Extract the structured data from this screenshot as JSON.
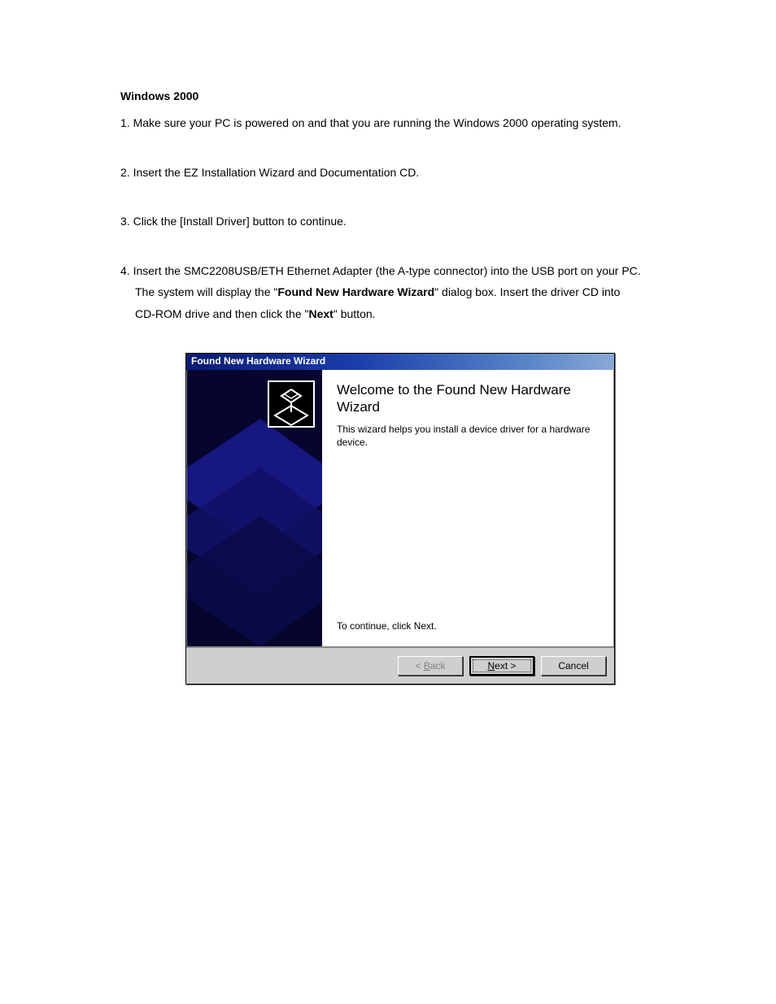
{
  "doc": {
    "heading": "Windows 2000",
    "step1_num": "1. ",
    "step1": "Make sure your PC is powered on and that you are running the Windows 2000 operating system.",
    "step2_num": "2. ",
    "step2": "Insert the EZ Installation Wizard and Documentation CD.",
    "step3_num": "3. ",
    "step3": "Click the [Install Driver] button to continue.",
    "step4_num": "4. ",
    "step4_a": "Insert the SMC2208USB/ETH Ethernet Adapter (the A-type connector) into the USB port on your PC.",
    "step4_b1": "The system will display the \"",
    "step4_b2": "Found New Hardware Wizard",
    "step4_b3": "\" dialog box. Insert the driver CD into",
    "step4_c1": "CD-ROM drive and then click the \"",
    "step4_c2": "Next",
    "step4_c3": "\" button."
  },
  "wizard": {
    "titlebar": "Found New Hardware Wizard",
    "heading": "Welcome to the Found New Hardware Wizard",
    "desc": "This wizard helps you install a device driver for a hardware device.",
    "continue": "To continue, click Next.",
    "buttons": {
      "back_pre": "< ",
      "back_mn": "B",
      "back_post": "ack",
      "next_mn": "N",
      "next_post": "ext >",
      "cancel": "Cancel"
    }
  }
}
